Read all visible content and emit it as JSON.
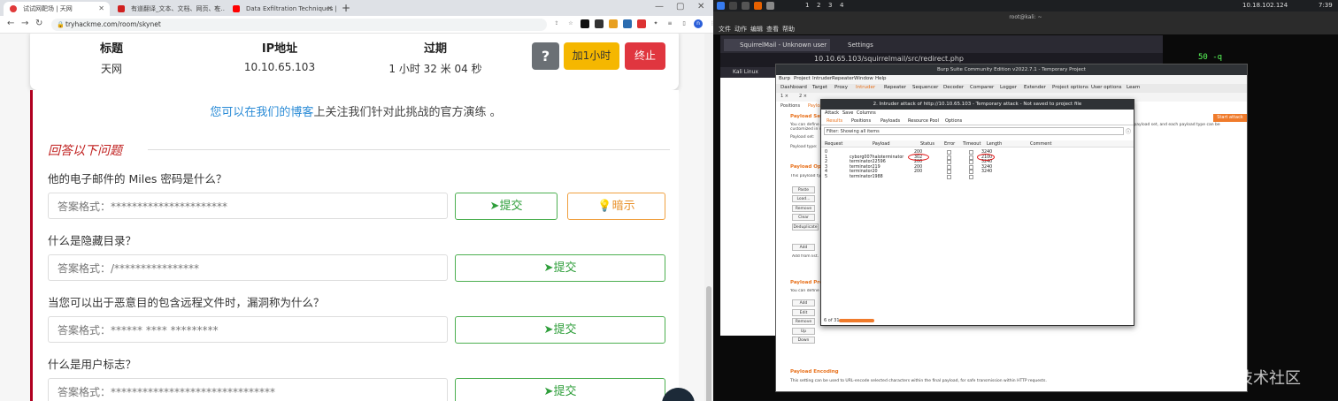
{
  "browser": {
    "tabs": [
      {
        "title": "试试网靶场 | 天网"
      },
      {
        "title": "有道翻译_文本、文档、网页、在..."
      },
      {
        "title": "Data Exfiltration Techniques | ..."
      }
    ],
    "new_tab": "+",
    "url": "tryhackme.com/room/skynet",
    "avatar_letter": "n"
  },
  "room": {
    "info": [
      {
        "label": "标题",
        "value": "天网"
      },
      {
        "label": "IP地址",
        "value": "10.10.65.103"
      },
      {
        "label": "过期",
        "value": "1 小时 32 米 04 秒"
      }
    ],
    "help_button": "?",
    "add_hour_button": "加1小时",
    "terminate_button": "终止",
    "blog_prefix": "您可以在我们的博客",
    "blog_suffix": "上关注我们针对此挑战的官方演练 。",
    "section_title": "回答以下问题"
  },
  "questions": [
    {
      "text": "他的电子邮件的 Miles 密码是什么？",
      "answer": "答案格式：**********************",
      "submit": "提交",
      "hint": "暗示"
    },
    {
      "text": "什么是隐藏目录？",
      "answer": "答案格式：/****************",
      "submit": "提交"
    },
    {
      "text": "当您可以出于恶意目的包含远程文件时，漏洞称为什么？",
      "answer": "答案格式：****** **** *********",
      "submit": "提交"
    },
    {
      "text": "什么是用户标志？",
      "answer": "答案格式：*******************************",
      "submit": "提交"
    }
  ],
  "kali": {
    "workspaces": [
      "1",
      "2",
      "3",
      "4"
    ],
    "ip": "10.18.102.124",
    "time": "7:39",
    "terminal_title": "root@kali: ~",
    "terminal_menu": [
      "文件",
      "动作",
      "编辑",
      "查看",
      "帮助"
    ],
    "terminal_fragment": "50 -q",
    "firefox_tabs": [
      "SquirrelMail - Unknown user",
      "Settings"
    ],
    "firefox_url": "10.10.65.103/squirrelmail/src/redirect.php",
    "bookmark": "Kali Linux"
  },
  "burp": {
    "title": "Burp Suite Community Edition v2022.7.1 - Temporary Project",
    "menu": [
      "Burp",
      "Project",
      "Intruder",
      "Repeater",
      "Window",
      "Help"
    ],
    "tabs": [
      "Dashboard",
      "Target",
      "Proxy",
      "Intruder",
      "Repeater",
      "Sequencer",
      "Decoder",
      "Comparer",
      "Logger",
      "Extender",
      "Project options",
      "User options",
      "Learn"
    ],
    "sub_tabs": [
      "1 ×",
      "2 ×"
    ],
    "panel_tabs": [
      "Positions",
      "Payloads"
    ],
    "sections": [
      {
        "title": "Payload Sets",
        "desc": "You can define one or more payload sets. The number of payload sets depends on the attack type defined in the Positions tab. Various payload types are available for each payload set, and each payload type can be customized in different ways."
      },
      {
        "title": "Payload Options",
        "desc": "This payload type lets you configure a simple list of strings that are used as payloads."
      },
      {
        "title": "Payload Processing",
        "desc": "You can define rules to perform various processing tasks on each payload before it is used."
      },
      {
        "title": "Payload Encoding",
        "desc": "This setting can be used to URL-encode selected characters within the final payload, for safe transmission within HTTP requests."
      }
    ],
    "payload_set_label": "Payload set:",
    "payload_type_label": "Payload type:",
    "list_buttons": [
      "Paste",
      "Load...",
      "Remove",
      "Clear",
      "Deduplicate"
    ],
    "add_button": "Add",
    "add_from_list": "Add from list...",
    "proc_buttons": [
      "Add",
      "Edit",
      "Remove",
      "Up",
      "Down"
    ],
    "start_attack": "Start attack"
  },
  "attack": {
    "title": "2. Intruder attack of http://10.10.65.103 - Temporary attack - Not saved to project file",
    "menu": [
      "Attack",
      "Save",
      "Columns"
    ],
    "tabs": [
      "Results",
      "Positions",
      "Payloads",
      "Resource Pool",
      "Options"
    ],
    "filter": "Filter: Showing all items",
    "columns": [
      "Request",
      "Payload",
      "Status",
      "Error",
      "Timeout",
      "Length",
      "Comment"
    ],
    "rows": [
      {
        "request": "0",
        "payload": "",
        "status": "200",
        "length": "3240"
      },
      {
        "request": "1",
        "payload": "cyborg007haloterminator",
        "status": "302",
        "length": "2100"
      },
      {
        "request": "2",
        "payload": "terminator22596",
        "status": "200",
        "length": "3240"
      },
      {
        "request": "3",
        "payload": "terminator219",
        "status": "200",
        "length": "3240"
      },
      {
        "request": "4",
        "payload": "terminator20",
        "status": "200",
        "length": "3240"
      },
      {
        "request": "5",
        "payload": "terminator1988",
        "status": "",
        "length": ""
      }
    ],
    "progress_text": "6 of 31"
  },
  "watermark": "@稀土掘金技术社区",
  "colors": {
    "accent_red": "#c0201f",
    "submit_green": "#2e9e3a",
    "burp_orange": "#f07b2b"
  }
}
